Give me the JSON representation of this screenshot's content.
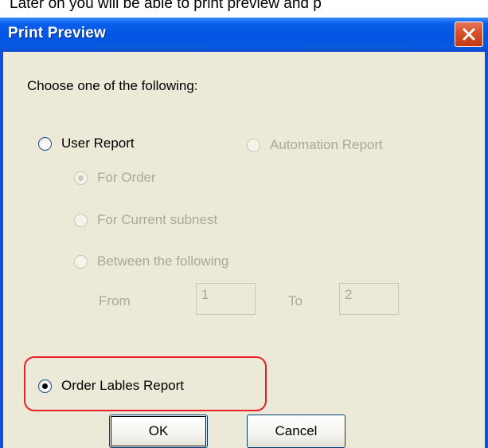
{
  "background_text": "Later on you will be able to print preview and p",
  "dialog": {
    "title": "Print Preview",
    "prompt": "Choose one of the following:",
    "options": {
      "user_report": "User Report",
      "automation_report": "Automation Report",
      "for_order": "For Order",
      "for_current_subnest": "For Current subnest",
      "between_following": "Between the following",
      "order_labels_report": "Order Lables Report"
    },
    "range": {
      "from_label": "From",
      "from_value": "1",
      "to_label": "To",
      "to_value": "2"
    },
    "buttons": {
      "ok": "OK",
      "cancel": "Cancel"
    }
  },
  "colors": {
    "titlebar": "#0254E2",
    "dialog_bg": "#ECE9D8",
    "highlight": "#E8202A",
    "close_button": "#D8522C"
  }
}
